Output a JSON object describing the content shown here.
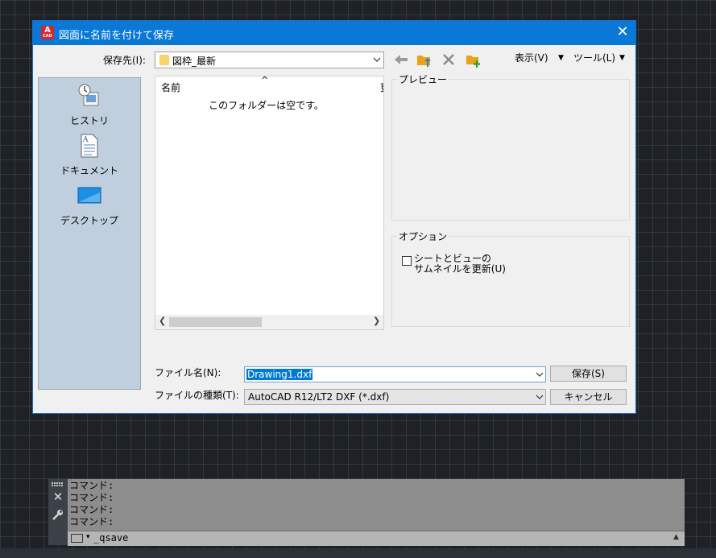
{
  "dialog": {
    "title": "図面に名前を付けて保存",
    "app_icon_letter": "A",
    "app_icon_sub": "CAD",
    "close_glyph": "✕",
    "save_in_label": "保存先(I):",
    "folder": "図枠_最新",
    "view_menu": "表示(V)",
    "tools_menu": "ツール(L)",
    "places": [
      {
        "label": "ヒストリ",
        "icon": "history-icon"
      },
      {
        "label": "ドキュメント",
        "icon": "documents-icon"
      },
      {
        "label": "デスクトップ",
        "icon": "desktop-icon"
      }
    ],
    "file_list": {
      "col_name": "名前",
      "col_date": "更",
      "empty_message": "このフォルダーは空です。"
    },
    "preview_label": "プレビュー",
    "options_label": "オプション",
    "option_thumbnail": "シートとビューの\nサムネイルを更新(U)",
    "file_name_label": "ファイル名(N):",
    "file_name_value": "Drawing1.dxf",
    "file_type_label": "ファイルの種類(T):",
    "file_type_value": "AutoCAD R12/LT2 DXF (*.dxf)",
    "save_button": "保存(S)",
    "cancel_button": "キャンセル"
  },
  "command_line": {
    "history": [
      "コマンド:",
      "コマンド:",
      "コマンド:",
      "コマンド:"
    ],
    "close_glyph": "✕",
    "input": "_qsave"
  },
  "colors": {
    "titlebar": "#0a78d7",
    "places_bg": "#bfcfdd",
    "selection": "#0078d7"
  }
}
